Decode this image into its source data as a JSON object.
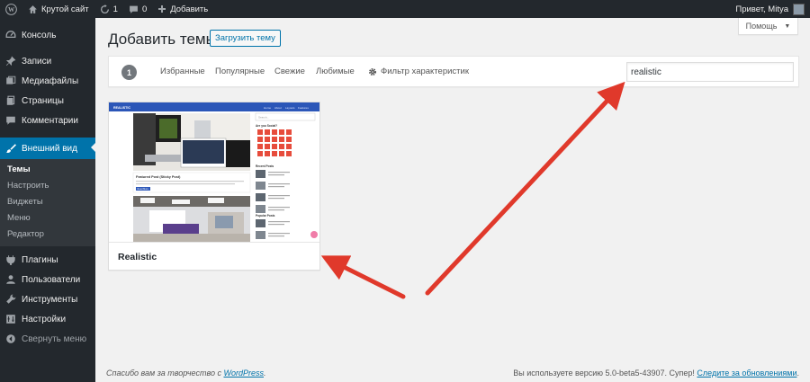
{
  "adminbar": {
    "site_name": "Крутой сайт",
    "updates_count": "1",
    "comments_count": "0",
    "new_label": "Добавить",
    "greeting": "Привет, Mitya"
  },
  "sidebar": {
    "items": [
      {
        "label": "Консоль",
        "icon": "dashboard-icon"
      },
      {
        "label": "Записи",
        "icon": "pin-icon"
      },
      {
        "label": "Медиафайлы",
        "icon": "media-icon"
      },
      {
        "label": "Страницы",
        "icon": "page-icon"
      },
      {
        "label": "Комментарии",
        "icon": "comment-icon"
      },
      {
        "label": "Внешний вид",
        "icon": "brush-icon"
      }
    ],
    "submenu": [
      "Темы",
      "Настроить",
      "Виджеты",
      "Меню",
      "Редактор"
    ],
    "items2": [
      {
        "label": "Плагины",
        "icon": "plugin-icon"
      },
      {
        "label": "Пользователи",
        "icon": "users-icon"
      },
      {
        "label": "Инструменты",
        "icon": "wrench-icon"
      },
      {
        "label": "Настройки",
        "icon": "settings-icon"
      }
    ],
    "collapse_label": "Свернуть меню"
  },
  "main": {
    "help_label": "Помощь",
    "title": "Добавить темы",
    "upload_label": "Загрузить тему",
    "count": "1",
    "filters": [
      "Избранные",
      "Популярные",
      "Свежие",
      "Любимые"
    ],
    "feature_filter": "Фильтр характеристик",
    "search_value": "realistic",
    "theme": {
      "name": "Realistic",
      "preview": {
        "brand": "REALISTIC",
        "nav": [
          "Home",
          "About",
          "Layouts",
          "Features"
        ],
        "post_title": "Featured Post (Sticky Post)",
        "button": "Read More",
        "widget1": "Are you Social?",
        "widget2": "Recent Posts",
        "widget3": "Popular Posts",
        "search_placeholder": "Search..."
      }
    }
  },
  "footer": {
    "left_prefix": "Спасибо вам за творчество с ",
    "left_link": "WordPress",
    "left_suffix": ".",
    "right_text": "Вы используете версию 5.0-beta5-43907. Супер! ",
    "right_link": "Следите за обновлениями",
    "right_suffix": "."
  },
  "colors": {
    "admin_dark": "#23282d",
    "accent": "#0073aa",
    "annotation_arrow": "#e0392b"
  }
}
